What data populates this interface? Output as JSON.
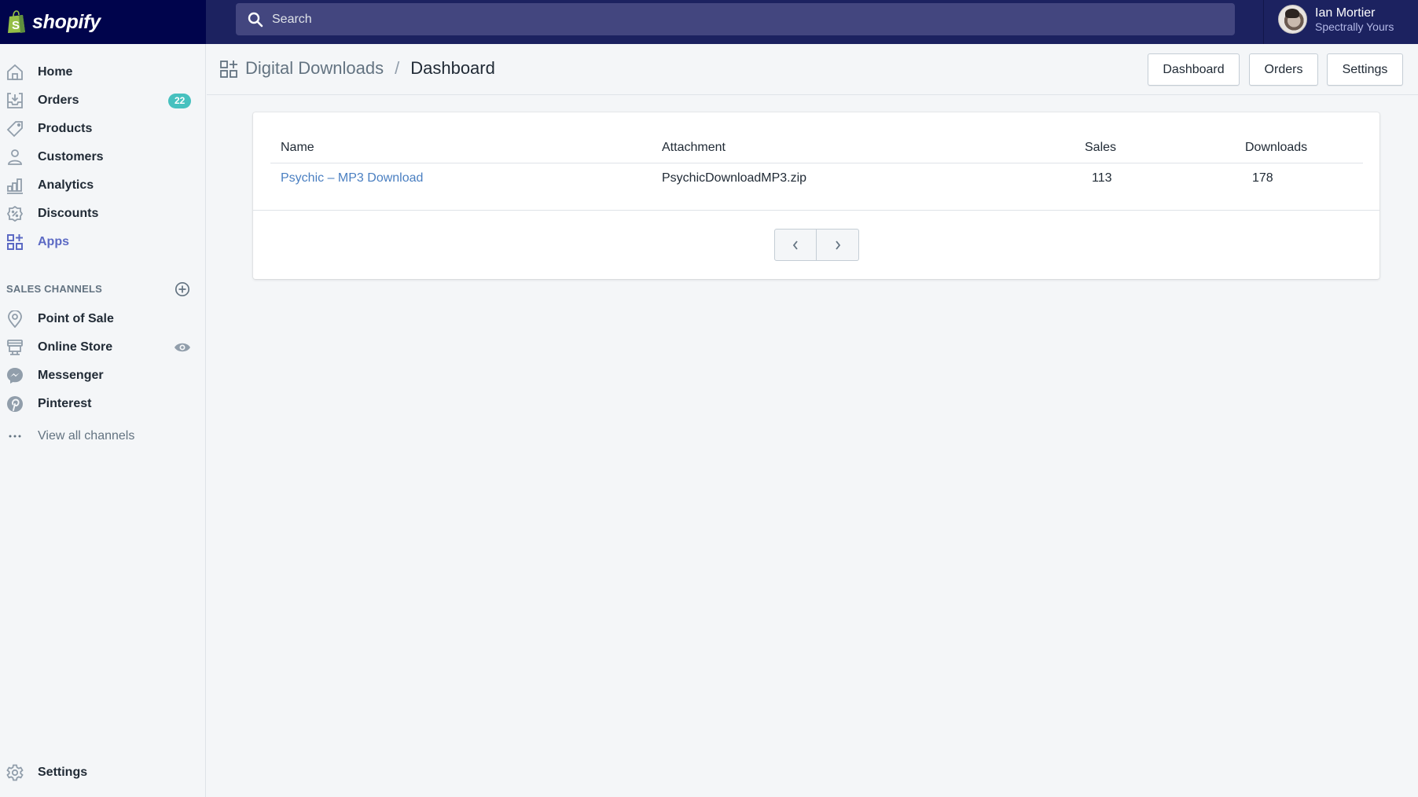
{
  "topbar": {
    "logo_text": "shopify",
    "search_placeholder": "Search",
    "user": {
      "name": "Ian Mortier",
      "shop": "Spectrally Yours"
    }
  },
  "sidebar": {
    "items": [
      {
        "label": "Home",
        "icon": "home-icon"
      },
      {
        "label": "Orders",
        "icon": "orders-icon",
        "badge": "22"
      },
      {
        "label": "Products",
        "icon": "tag-icon"
      },
      {
        "label": "Customers",
        "icon": "person-icon"
      },
      {
        "label": "Analytics",
        "icon": "bar-chart-icon"
      },
      {
        "label": "Discounts",
        "icon": "discount-icon"
      },
      {
        "label": "Apps",
        "icon": "apps-icon",
        "active": true
      }
    ],
    "sales_channels_title": "SALES CHANNELS",
    "channels": [
      {
        "label": "Point of Sale",
        "icon": "location-pin-icon"
      },
      {
        "label": "Online Store",
        "icon": "store-icon"
      },
      {
        "label": "Messenger",
        "icon": "messenger-icon"
      },
      {
        "label": "Pinterest",
        "icon": "pinterest-icon"
      }
    ],
    "view_all_label": "View all channels",
    "settings_label": "Settings",
    "accent_color": "#5c6ac4",
    "badge_color": "#47c1bf"
  },
  "header": {
    "breadcrumb_parent": "Digital Downloads",
    "breadcrumb_separator": "/",
    "breadcrumb_current": "Dashboard",
    "buttons": [
      "Dashboard",
      "Orders",
      "Settings"
    ]
  },
  "table": {
    "columns": [
      "Name",
      "Attachment",
      "Sales",
      "Downloads"
    ],
    "rows": [
      {
        "name": "Psychic – MP3 Download",
        "attachment": "PsychicDownloadMP3.zip",
        "sales": "113",
        "downloads": "178"
      }
    ],
    "link_color": "#4a7fc1"
  },
  "pagination": {
    "prev": "previous-page",
    "next": "next-page"
  }
}
